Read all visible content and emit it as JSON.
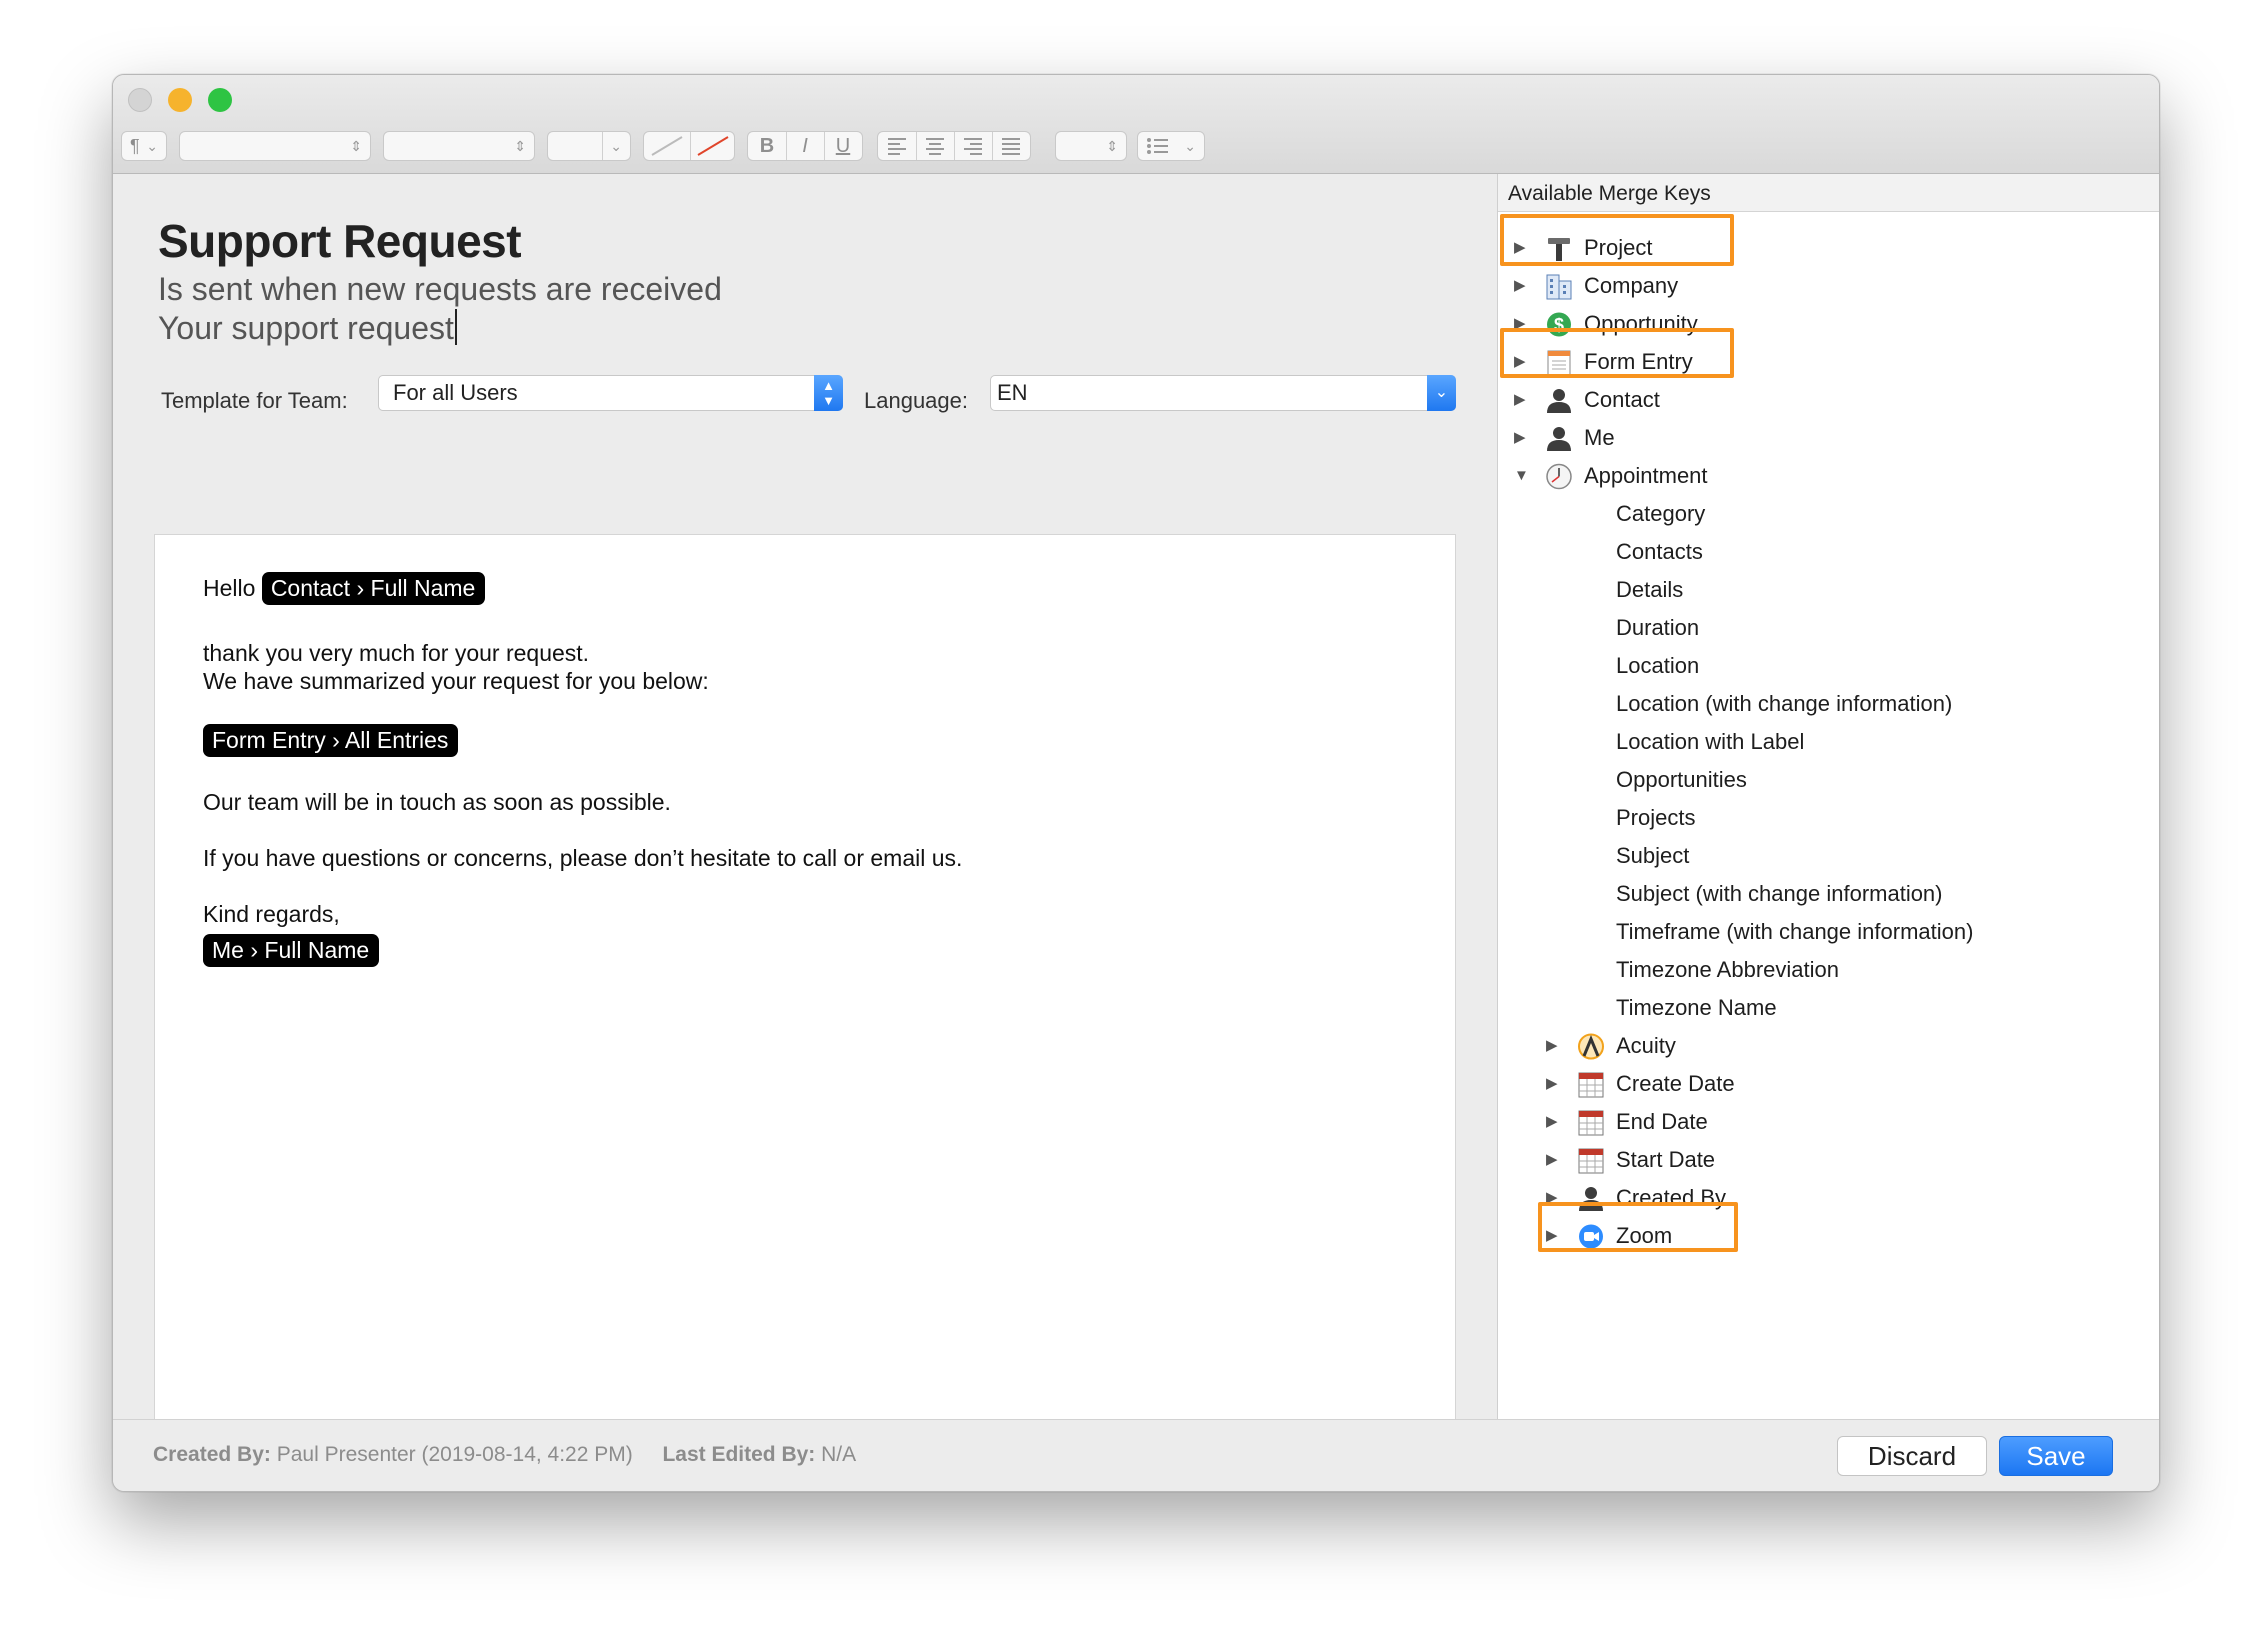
{
  "window": {
    "toolbar": {
      "paragraph_label": "¶",
      "bold": "B",
      "italic": "I",
      "underline": "U"
    }
  },
  "template": {
    "title": "Support Request",
    "description": "Is sent when new requests are received",
    "subject": "Your support request",
    "team_label": "Template for Team:",
    "team_value": "For all Users",
    "language_label": "Language:",
    "language_value": "EN"
  },
  "email": {
    "greeting": "Hello",
    "greeting_token": "Contact › Full Name",
    "line1": "thank you very much for your request.",
    "line2": "We have summarized your request for you below:",
    "entries_token": "Form Entry › All Entries",
    "line3": "Our team will be in touch as soon as possible.",
    "line4": "If you have questions or concerns, please don’t hesitate to call or email us.",
    "closing": "Kind regards,",
    "signature_token": "Me › Full Name"
  },
  "merge_keys": {
    "header": "Available Merge Keys",
    "top_items": [
      {
        "label": "Project",
        "icon": "hammer-icon"
      },
      {
        "label": "Company",
        "icon": "building-icon"
      },
      {
        "label": "Opportunity",
        "icon": "dollar-icon"
      },
      {
        "label": "Form Entry",
        "icon": "form-icon"
      },
      {
        "label": "Contact",
        "icon": "person-icon"
      },
      {
        "label": "Me",
        "icon": "person-icon"
      },
      {
        "label": "Appointment",
        "icon": "clock-icon"
      }
    ],
    "appointment_fields": [
      "Category",
      "Contacts",
      "Details",
      "Duration",
      "Location",
      "Location (with change information)",
      "Location with Label",
      "Opportunities",
      "Projects",
      "Subject",
      "Subject (with change information)",
      "Timeframe (with change information)",
      "Timezone Abbreviation",
      "Timezone Name"
    ],
    "appointment_subgroups": [
      {
        "label": "Acuity",
        "icon": "acuity-icon"
      },
      {
        "label": "Create Date",
        "icon": "calendar-icon"
      },
      {
        "label": "End Date",
        "icon": "calendar-icon"
      },
      {
        "label": "Start Date",
        "icon": "calendar-icon"
      },
      {
        "label": "Created By",
        "icon": "person-icon"
      },
      {
        "label": "Zoom",
        "icon": "zoom-icon"
      }
    ],
    "highlight_color": "#f7931e"
  },
  "footer": {
    "created_by_label": "Created By:",
    "created_by_value": "Paul Presenter (2019-08-14, 4:22 PM)",
    "last_edited_label": "Last Edited By:",
    "last_edited_value": "N/A",
    "discard_label": "Discard",
    "save_label": "Save"
  },
  "colors": {
    "accent": "#1c76f2",
    "token_bg": "#000000"
  }
}
